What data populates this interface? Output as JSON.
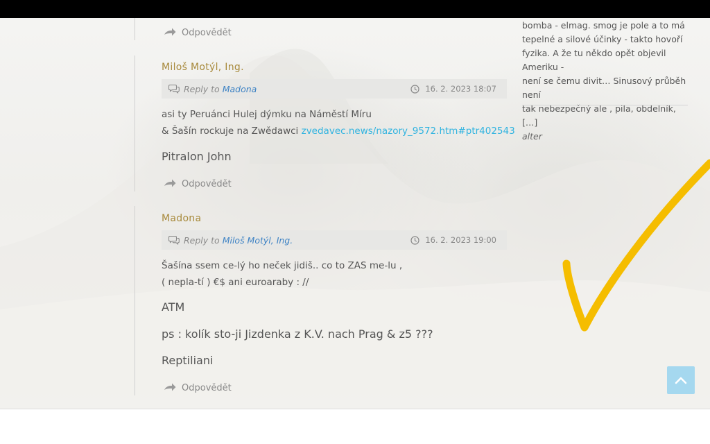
{
  "thread": {
    "reply_label": "Odpovědět",
    "reply_prefix": "Reply to",
    "comments": [
      {
        "author": "Miloš Motýl, Ing.",
        "reply_to": "Madona",
        "date": "16. 2. 2023 18:07",
        "line1": "asi ty Peruánci Hulej dýmku na Náměstí Míru",
        "line2_text": "& Šašín rockuje na Zwědawci ",
        "line2_link": "zvedavec.news/nazory_9572.htm#ptr402543",
        "big1": "Pitralon John"
      },
      {
        "author": "Madona",
        "reply_to": "Miloš Motýl, Ing.",
        "date": "16. 2. 2023 19:00",
        "line1": "Šašína ssem ce-lý ho neček jidiš.. co to ZAS me-lu ,",
        "line2": "( nepla-tí ) €$ ani euroaraby : //",
        "big1": "ATM",
        "big2": "ps : kolík sto-ji Jizdenka z K.V. nach Prag & z5 ???",
        "big3": "Reptiliani"
      }
    ]
  },
  "sidebar": {
    "lines": [
      "bomba - elmag. smog je pole a to má",
      "tepelné a silové účinky - takto hovoří",
      "fyzika. A že tu někdo opět objevil Ameriku -",
      "není se čemu divit… Sinusový průběh není",
      "tak nebezpečný ale , pila, obdelník, […]"
    ],
    "signature": "alter"
  },
  "colors": {
    "author": "#a88a3c",
    "link": "#3d82c4",
    "url_link": "#2fb3e0",
    "checkmark": "#f5bd00",
    "to_top": "#a5d8ef"
  },
  "icons": {
    "reply": "reply-arrow-icon",
    "comments": "comments-icon",
    "clock": "clock-icon",
    "to_top": "chevron-up-icon"
  }
}
